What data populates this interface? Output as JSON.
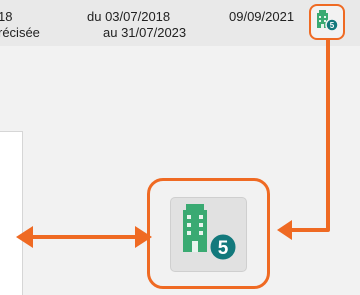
{
  "row": {
    "col1_line1": "18",
    "col1_line2": "récisée",
    "col2_line1": "du 03/07/2018",
    "col2_line2": "au 31/07/2023",
    "col3_line1": "09/09/2021"
  },
  "building_button": {
    "icon": "building-icon",
    "badge_count": "5"
  },
  "colors": {
    "accent": "#ef6a23",
    "icon_green": "#3aaa72",
    "badge_teal": "#13797c"
  }
}
